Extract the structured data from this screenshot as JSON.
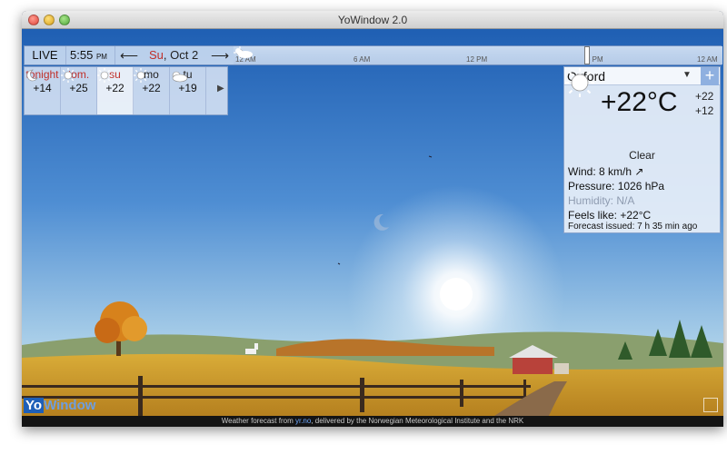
{
  "window": {
    "title": "YoWindow 2.0"
  },
  "topbar": {
    "live_label": "LIVE",
    "time": "5:55",
    "time_suffix": "PM",
    "date_dow": "Su",
    "date_rest": ", Oct 2",
    "timeline_ticks": [
      "12 AM",
      "6 AM",
      "12 PM",
      "6 PM",
      "12 AM"
    ]
  },
  "forecast": {
    "days": [
      {
        "label": "tonight",
        "temp": "+14",
        "icon": "moon-icon"
      },
      {
        "label": "tom.",
        "temp": "+25",
        "icon": "sun-icon"
      },
      {
        "label": "su",
        "temp": "+22",
        "icon": "sun-icon"
      },
      {
        "label": "mo",
        "temp": "+22",
        "icon": "sun-icon"
      },
      {
        "label": "tu",
        "temp": "+19",
        "icon": "cloud-icon"
      }
    ],
    "next_glyph": "▶"
  },
  "current": {
    "city": "Oxford",
    "temperature": "+22°C",
    "high": "+22",
    "low": "+12",
    "condition": "Clear",
    "wind_label": "Wind:",
    "wind_value": "8 km/h",
    "wind_glyph": "↗",
    "pressure_label": "Pressure:",
    "pressure_value": "1026 hPa",
    "humidity_label": "Humidity:",
    "humidity_value": "N/A",
    "feels_label": "Feels like:",
    "feels_value": "+22°C",
    "issued_label": "Forecast issued:",
    "issued_value": "7 h 35 min ago"
  },
  "logo": {
    "part1": "Yo",
    "part2": "Window"
  },
  "status": {
    "prefix": "Weather forecast from",
    "link": "yr.no",
    "suffix": ", delivered by the Norwegian Meteorological Institute and the NRK"
  },
  "colors": {
    "accent_red": "#c0302a",
    "sky_top": "#1f5fb3",
    "field": "#c89a2a"
  }
}
